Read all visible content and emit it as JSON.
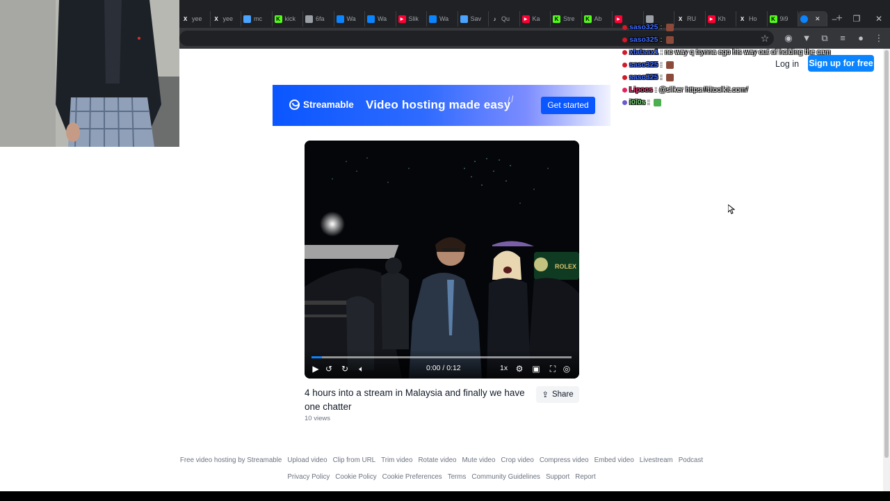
{
  "browser": {
    "tabs": [
      {
        "label": "yee",
        "favicon": "x",
        "color": "#ffffff"
      },
      {
        "label": "yee",
        "favicon": "x",
        "color": "#ffffff"
      },
      {
        "label": "mc",
        "favicon": "image",
        "color": "#4aa3ff"
      },
      {
        "label": "kick",
        "favicon": "kick",
        "color": "#53fc18"
      },
      {
        "label": "6fa",
        "favicon": "globe",
        "color": "#9aa0a6"
      },
      {
        "label": "Wa",
        "favicon": "streamable",
        "color": "#0a84ff"
      },
      {
        "label": "Wa",
        "favicon": "streamable",
        "color": "#0a84ff"
      },
      {
        "label": "Slik",
        "favicon": "youtube",
        "color": "#ff0033"
      },
      {
        "label": "Wa",
        "favicon": "streamable",
        "color": "#0a84ff"
      },
      {
        "label": "Sav",
        "favicon": "check",
        "color": "#4aa3ff"
      },
      {
        "label": "Qu",
        "favicon": "tiktok",
        "color": "#ffffff"
      },
      {
        "label": "Ka",
        "favicon": "youtube",
        "color": "#ff0033"
      },
      {
        "label": "Stre",
        "favicon": "kick",
        "color": "#53fc18"
      },
      {
        "label": "Ab",
        "favicon": "kick",
        "color": "#53fc18"
      },
      {
        "label": "",
        "favicon": "youtube",
        "color": "#ff0033"
      },
      {
        "label": "",
        "favicon": "window",
        "color": "#9aa0a6"
      },
      {
        "label": "RU",
        "favicon": "x",
        "color": "#ffffff"
      },
      {
        "label": "Kh",
        "favicon": "youtube",
        "color": "#ff0033"
      },
      {
        "label": "Ho",
        "favicon": "x",
        "color": "#ffffff"
      },
      {
        "label": "9i9",
        "favicon": "kick",
        "color": "#53fc18"
      }
    ],
    "active_tab_icon": "streamable-icon",
    "new_tab": "+",
    "window_controls": [
      "–",
      "❐",
      "✕"
    ]
  },
  "header": {
    "login": "Log in",
    "signup": "Sign up for free"
  },
  "banner": {
    "logo": "Streamable",
    "tagline": "Video hosting made easy",
    "cta": "Get started"
  },
  "video": {
    "time": "0:00 / 0:12",
    "speed": "1x",
    "progress": 0.04,
    "title": "4 hours into a stream in Malaysia and finally we have one chatter",
    "views": "10 views",
    "share": "Share"
  },
  "footer": {
    "row1": [
      "Free video hosting by Streamable",
      "Upload video",
      "Clip from URL",
      "Trim video",
      "Rotate video",
      "Mute video",
      "Crop video",
      "Compress video",
      "Embed video",
      "Livestream",
      "Podcast"
    ],
    "row2": [
      "Privacy Policy",
      "Cookie Policy",
      "Cookie Preferences",
      "Terms",
      "Community Guidelines",
      "Support",
      "Report"
    ]
  },
  "chat": [
    {
      "user": "saso325",
      "sep": ":",
      "msg": "",
      "user_color": "#3f6bff",
      "badge": "#d11a2a",
      "emote": true
    },
    {
      "user": "saso325",
      "sep": ":",
      "msg": "",
      "user_color": "#3f6bff",
      "badge": "#d11a2a",
      "emote": true
    },
    {
      "user": "xtatsax1",
      "sep": ":",
      "msg": "no way q trynna ego his way out of holding the cam",
      "user_color": "#3f6bff",
      "badge": "#d11a2a",
      "emote": false
    },
    {
      "user": "saso325",
      "sep": ":",
      "msg": "",
      "user_color": "#3f6bff",
      "badge": "#d11a2a",
      "emote": true
    },
    {
      "user": "saso325",
      "sep": ":",
      "msg": "",
      "user_color": "#3f6bff",
      "badge": "#d11a2a",
      "emote": true
    },
    {
      "user": "Lipocs",
      "sep": ":",
      "msg": "@sliker https://titoolkit.com/",
      "user_color": "#ff3d7f",
      "badge": "#e0245e",
      "emote": false
    },
    {
      "user": "i0i0s",
      "sep": ":",
      "msg": "",
      "user_color": "#7dd87d",
      "badge": "#6a5acd",
      "emote": true
    }
  ]
}
